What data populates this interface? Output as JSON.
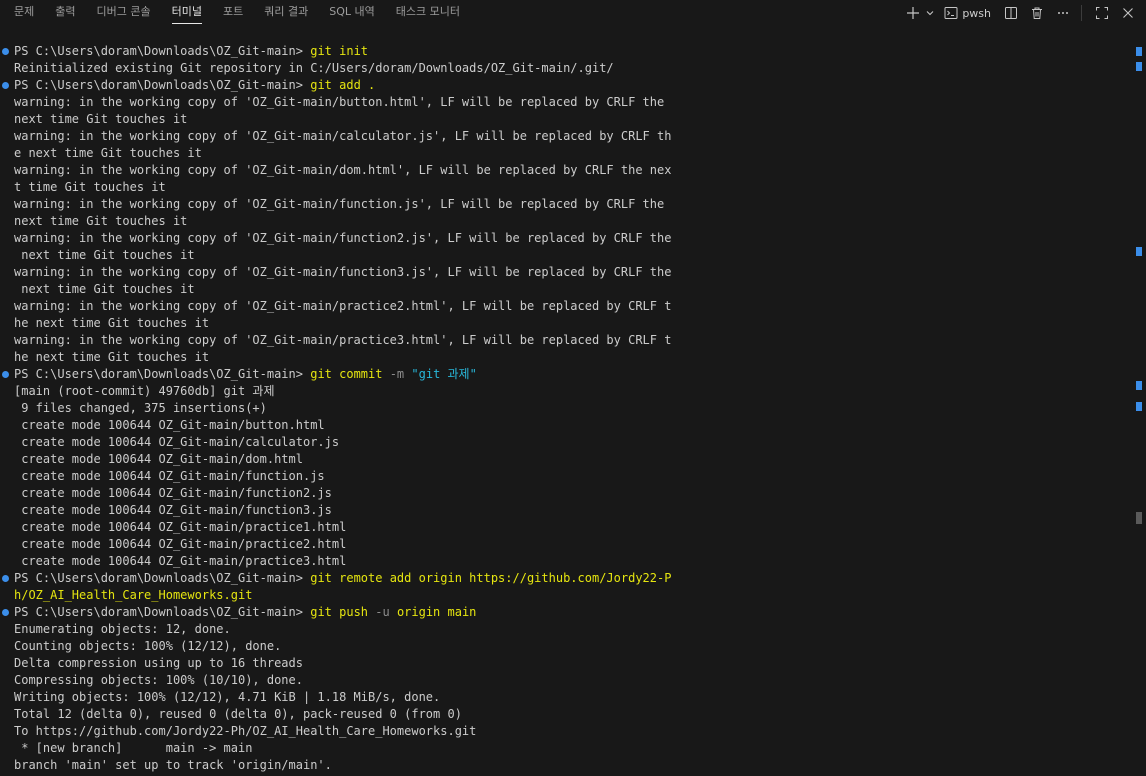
{
  "tabs": [
    {
      "label": "문제"
    },
    {
      "label": "출력"
    },
    {
      "label": "디버그 콘솔"
    },
    {
      "label": "터미널"
    },
    {
      "label": "포트"
    },
    {
      "label": "쿼리 결과"
    },
    {
      "label": "SQL 내역"
    },
    {
      "label": "태스크 모니터"
    }
  ],
  "active_tab": "터미널",
  "toolbar": {
    "shell_label": "pwsh",
    "icons": [
      "plus-icon",
      "chevron-down-icon",
      "terminal-icon",
      "split-icon",
      "trash-icon",
      "more-icon",
      "maximize-icon",
      "close-icon"
    ]
  },
  "colors": {
    "background": "#181818",
    "text": "#cccccc",
    "command": "#e5e510",
    "flag": "#8c8c8c",
    "string": "#29b8db",
    "prompt_dot": "#3b8eea"
  },
  "terminal": {
    "prompt": "PS C:\\Users\\doram\\Downloads\\OZ_Git-main> ",
    "blocks": [
      {
        "command": [
          {
            "t": "git init",
            "c": "cmd"
          }
        ],
        "output": [
          "Reinitialized existing Git repository in C:/Users/doram/Downloads/OZ_Git-main/.git/"
        ]
      },
      {
        "command": [
          {
            "t": "git add .",
            "c": "cmd"
          }
        ],
        "output": [
          "warning: in the working copy of 'OZ_Git-main/button.html', LF will be replaced by CRLF the",
          "next time Git touches it",
          "warning: in the working copy of 'OZ_Git-main/calculator.js', LF will be replaced by CRLF th",
          "e next time Git touches it",
          "warning: in the working copy of 'OZ_Git-main/dom.html', LF will be replaced by CRLF the nex",
          "t time Git touches it",
          "warning: in the working copy of 'OZ_Git-main/function.js', LF will be replaced by CRLF the",
          "next time Git touches it",
          "warning: in the working copy of 'OZ_Git-main/function2.js', LF will be replaced by CRLF the",
          " next time Git touches it",
          "warning: in the working copy of 'OZ_Git-main/function3.js', LF will be replaced by CRLF the",
          " next time Git touches it",
          "warning: in the working copy of 'OZ_Git-main/practice2.html', LF will be replaced by CRLF t",
          "he next time Git touches it",
          "warning: in the working copy of 'OZ_Git-main/practice3.html', LF will be replaced by CRLF t",
          "he next time Git touches it"
        ]
      },
      {
        "command": [
          {
            "t": "git commit ",
            "c": "cmd"
          },
          {
            "t": "-m ",
            "c": "flag"
          },
          {
            "t": "\"git 과제\"",
            "c": "str"
          }
        ],
        "output": [
          "[main (root-commit) 49760db] git 과제",
          " 9 files changed, 375 insertions(+)",
          " create mode 100644 OZ_Git-main/button.html",
          " create mode 100644 OZ_Git-main/calculator.js",
          " create mode 100644 OZ_Git-main/dom.html",
          " create mode 100644 OZ_Git-main/function.js",
          " create mode 100644 OZ_Git-main/function2.js",
          " create mode 100644 OZ_Git-main/function3.js",
          " create mode 100644 OZ_Git-main/practice1.html",
          " create mode 100644 OZ_Git-main/practice2.html",
          " create mode 100644 OZ_Git-main/practice3.html"
        ]
      },
      {
        "command": [
          {
            "t": "git remote add origin https://github.com/Jordy22-P",
            "c": "cmd"
          }
        ],
        "output_cmd_wrap": "h/OZ_AI_Health_Care_Homeworks.git",
        "output": []
      },
      {
        "command": [
          {
            "t": "git push ",
            "c": "cmd"
          },
          {
            "t": "-u ",
            "c": "flag"
          },
          {
            "t": "origin main",
            "c": "cmd"
          }
        ],
        "output": [
          "Enumerating objects: 12, done.",
          "Counting objects: 100% (12/12), done.",
          "Delta compression using up to 16 threads",
          "Compressing objects: 100% (10/10), done.",
          "Writing objects: 100% (12/12), 4.71 KiB | 1.18 MiB/s, done.",
          "Total 12 (delta 0), reused 0 (delta 0), pack-reused 0 (from 0)",
          "To https://github.com/Jordy22-Ph/OZ_AI_Health_Care_Homeworks.git",
          " * [new branch]      main -> main",
          "branch 'main' set up to track 'origin/main'."
        ]
      }
    ]
  }
}
